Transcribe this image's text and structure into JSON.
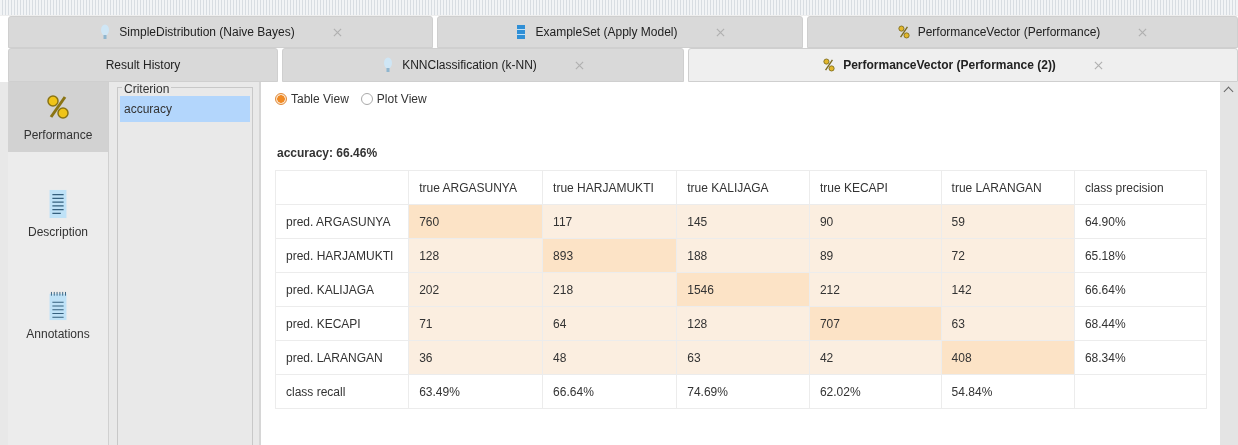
{
  "top_tabs": [
    {
      "label": "SimpleDistribution (Naive Bayes)",
      "kind": "model",
      "selected": false
    },
    {
      "label": "ExampleSet (Apply Model)",
      "kind": "data",
      "selected": false
    },
    {
      "label": "PerformanceVector (Performance)",
      "kind": "performance",
      "selected": false
    }
  ],
  "second_tabs": [
    {
      "label": "Result History",
      "kind": "history",
      "selected": false
    },
    {
      "label": "KNNClassification (k-NN)",
      "kind": "model",
      "selected": false
    },
    {
      "label": "PerformanceVector (Performance (2))",
      "kind": "performance",
      "selected": true
    }
  ],
  "sidebar": {
    "items": [
      {
        "label": "Performance",
        "kind": "performance",
        "selected": true
      },
      {
        "label": "Description",
        "kind": "description",
        "selected": false
      },
      {
        "label": "Annotations",
        "kind": "annotations",
        "selected": false
      }
    ]
  },
  "criterion": {
    "title": "Criterion",
    "items": [
      {
        "label": "accuracy",
        "selected": true
      }
    ]
  },
  "views": [
    {
      "label": "Table View",
      "selected": true
    },
    {
      "label": "Plot View",
      "selected": false
    }
  ],
  "result_title": "accuracy: 66.46%",
  "table": {
    "columns": [
      "true ARGASUNYA",
      "true HARJAMUKTI",
      "true KALIJAGA",
      "true KECAPI",
      "true LARANGAN",
      "class precision"
    ],
    "rows": [
      {
        "label": "pred. ARGASUNYA",
        "cells": [
          {
            "value": "760",
            "kind": "hit"
          },
          {
            "value": "117",
            "kind": "miss"
          },
          {
            "value": "145",
            "kind": "miss"
          },
          {
            "value": "90",
            "kind": "miss"
          },
          {
            "value": "59",
            "kind": "miss"
          },
          {
            "value": "64.90%",
            "kind": "metric"
          }
        ]
      },
      {
        "label": "pred. HARJAMUKTI",
        "cells": [
          {
            "value": "128",
            "kind": "miss"
          },
          {
            "value": "893",
            "kind": "hit"
          },
          {
            "value": "188",
            "kind": "miss"
          },
          {
            "value": "89",
            "kind": "miss"
          },
          {
            "value": "72",
            "kind": "miss"
          },
          {
            "value": "65.18%",
            "kind": "metric"
          }
        ]
      },
      {
        "label": "pred. KALIJAGA",
        "cells": [
          {
            "value": "202",
            "kind": "miss"
          },
          {
            "value": "218",
            "kind": "miss"
          },
          {
            "value": "1546",
            "kind": "hit"
          },
          {
            "value": "212",
            "kind": "miss"
          },
          {
            "value": "142",
            "kind": "miss"
          },
          {
            "value": "66.64%",
            "kind": "metric"
          }
        ]
      },
      {
        "label": "pred. KECAPI",
        "cells": [
          {
            "value": "71",
            "kind": "miss"
          },
          {
            "value": "64",
            "kind": "miss"
          },
          {
            "value": "128",
            "kind": "miss"
          },
          {
            "value": "707",
            "kind": "hit"
          },
          {
            "value": "63",
            "kind": "miss"
          },
          {
            "value": "68.44%",
            "kind": "metric"
          }
        ]
      },
      {
        "label": "pred. LARANGAN",
        "cells": [
          {
            "value": "36",
            "kind": "miss"
          },
          {
            "value": "48",
            "kind": "miss"
          },
          {
            "value": "63",
            "kind": "miss"
          },
          {
            "value": "42",
            "kind": "miss"
          },
          {
            "value": "408",
            "kind": "hit"
          },
          {
            "value": "68.34%",
            "kind": "metric"
          }
        ]
      },
      {
        "label": "class recall",
        "cells": [
          {
            "value": "63.49%",
            "kind": "metric"
          },
          {
            "value": "66.64%",
            "kind": "metric"
          },
          {
            "value": "74.69%",
            "kind": "metric"
          },
          {
            "value": "62.02%",
            "kind": "metric"
          },
          {
            "value": "54.84%",
            "kind": "metric"
          },
          {
            "kind": "metric"
          }
        ]
      }
    ]
  }
}
